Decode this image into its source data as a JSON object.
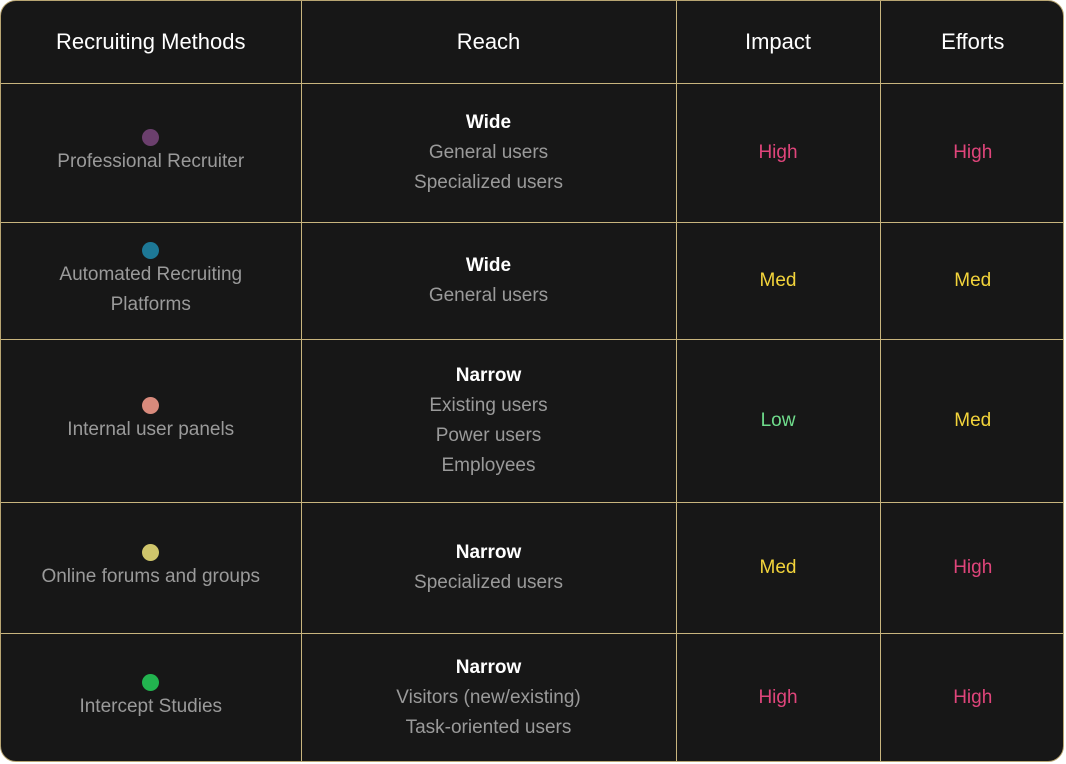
{
  "headers": [
    "Recruiting Methods",
    "Reach",
    "Impact",
    "Efforts"
  ],
  "rows": [
    {
      "method_lines": [
        "Professional Recruiter"
      ],
      "dot_color": "#6b3f6d",
      "reach": "Wide",
      "reach_details": [
        "General users",
        "Specialized users"
      ],
      "impact": "High",
      "impact_color": "#e0457b",
      "efforts": "High",
      "efforts_color": "#e0457b"
    },
    {
      "method_lines": [
        "Automated Recruiting",
        "Platforms"
      ],
      "dot_color": "#1d7896",
      "reach": "Wide",
      "reach_details": [
        "General users"
      ],
      "impact": "Med",
      "impact_color": "#f3d43b",
      "efforts": "Med",
      "efforts_color": "#f3d43b"
    },
    {
      "method_lines": [
        "Internal user panels"
      ],
      "dot_color": "#d88a7c",
      "reach": "Narrow",
      "reach_details": [
        "Existing users",
        "Power users",
        "Employees"
      ],
      "impact": "Low",
      "impact_color": "#6fdc8c",
      "efforts": "Med",
      "efforts_color": "#f3d43b"
    },
    {
      "method_lines": [
        "Online forums and groups"
      ],
      "dot_color": "#cfc56b",
      "reach": "Narrow",
      "reach_details": [
        "Specialized users"
      ],
      "impact": "Med",
      "impact_color": "#f3d43b",
      "efforts": "High",
      "efforts_color": "#e0457b"
    },
    {
      "method_lines": [
        "Intercept Studies"
      ],
      "dot_color": "#22b34f",
      "reach": "Narrow",
      "reach_details": [
        "Visitors (new/existing)",
        "Task-oriented users"
      ],
      "impact": "High",
      "impact_color": "#e0457b",
      "efforts": "High",
      "efforts_color": "#e0457b"
    }
  ]
}
